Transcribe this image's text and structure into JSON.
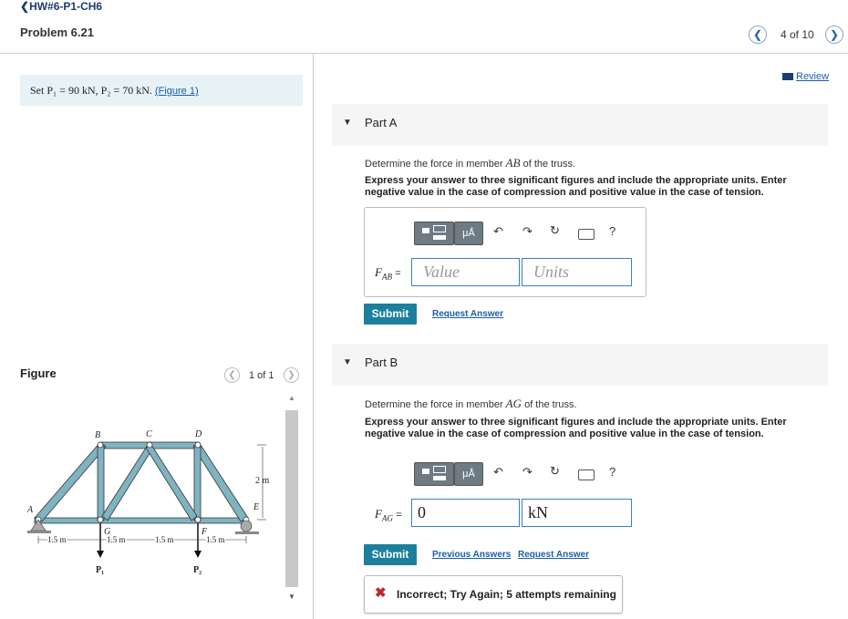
{
  "header": {
    "breadcrumb": "HW#6-P1-CH6",
    "problem_title": "Problem 6.21",
    "counter": "4 of 10",
    "review_label": "Review"
  },
  "problem": {
    "statement_prefix": "Set ",
    "statement_vals": "P₁ = 90 kN,  P₂ = 70 kN.",
    "figure_link": "(Figure 1)"
  },
  "figure": {
    "heading": "Figure",
    "counter": "1 of 1",
    "labels": {
      "A": "A",
      "B": "B",
      "C": "C",
      "D": "D",
      "E": "E",
      "F": "F",
      "G": "G",
      "height": "2 m",
      "d1": "1.5 m",
      "d2": "1.5 m",
      "d3": "1.5 m",
      "d4": "1.5 m",
      "P1": "P₁",
      "P2": "P₂"
    }
  },
  "partA": {
    "title": "Part A",
    "question_prefix": "Determine the force in member ",
    "member": "AB",
    "question_suffix": " of the truss.",
    "instructions": "Express your answer to three significant figures and include the appropriate units. Enter negative value in the case of compression and positive value in the case of tension.",
    "var_label": "F",
    "var_sub": "AB",
    "equals": "=",
    "value_placeholder": "Value",
    "units_placeholder": "Units",
    "submit_label": "Submit",
    "request_answer_label": "Request Answer"
  },
  "partB": {
    "title": "Part B",
    "question_prefix": "Determine the force in member ",
    "member": "AG",
    "question_suffix": " of the truss.",
    "instructions": "Express your answer to three significant figures and include the appropriate units. Enter negative value in the case of compression and positive value in the case of tension.",
    "var_label": "F",
    "var_sub": "AG",
    "equals": "=",
    "value": "0",
    "units": "kN",
    "submit_label": "Submit",
    "previous_answers_label": "Previous Answers",
    "request_answer_label": "Request Answer",
    "feedback": "Incorrect; Try Again; 5 attempts remaining"
  },
  "toolbar": {
    "mu_label": "μÅ",
    "help_label": "?"
  },
  "colors": {
    "accent": "#1d7f9c",
    "truss_fill": "#7fb3c2",
    "link": "#1a5fa8",
    "error": "#c0262d"
  }
}
